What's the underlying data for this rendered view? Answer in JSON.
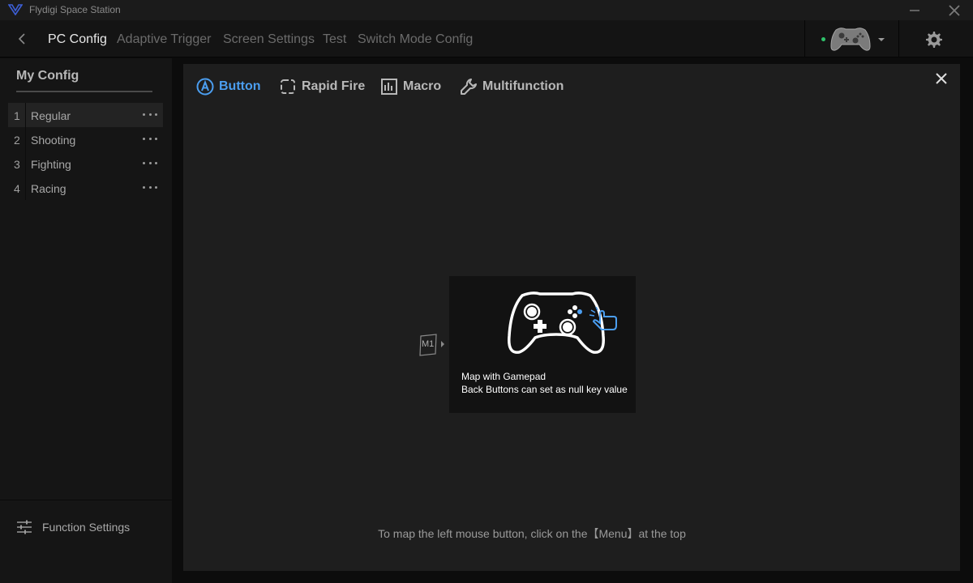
{
  "app": {
    "title": "Flydigi Space Station",
    "logo_icon": "flydigi-logo-icon"
  },
  "colors": {
    "accent": "#4b9ef0",
    "status_online": "#2fc26b",
    "background": "#0c0c0c",
    "panel": "#1e1e1e"
  },
  "nav": {
    "tabs": [
      {
        "label": "PC Config",
        "active": true
      },
      {
        "label": "Adaptive Trigger",
        "active": false
      },
      {
        "label": "Screen Settings",
        "active": false
      },
      {
        "label": "Test",
        "active": false
      },
      {
        "label": "Switch Mode Config",
        "active": false
      }
    ]
  },
  "sidebar": {
    "title": "My Config",
    "items": [
      {
        "num": "1",
        "label": "Regular",
        "active": true
      },
      {
        "num": "2",
        "label": "Shooting",
        "active": false
      },
      {
        "num": "3",
        "label": "Fighting",
        "active": false
      },
      {
        "num": "4",
        "label": "Racing",
        "active": false
      }
    ],
    "function_settings": "Function Settings"
  },
  "panel": {
    "tabs": [
      {
        "label": "Button",
        "icon": "a-button-icon",
        "active": true
      },
      {
        "label": "Rapid Fire",
        "icon": "rapid-fire-icon",
        "active": false
      },
      {
        "label": "Macro",
        "icon": "macro-icon",
        "active": false
      },
      {
        "label": "Multifunction",
        "icon": "wrench-icon",
        "active": false
      }
    ],
    "m1_label": "M1",
    "card": {
      "line1": "Map with Gamepad",
      "line2": "Back Buttons can set as null key value"
    },
    "hint": "To map the left mouse button, click on the【Menu】at the top"
  }
}
